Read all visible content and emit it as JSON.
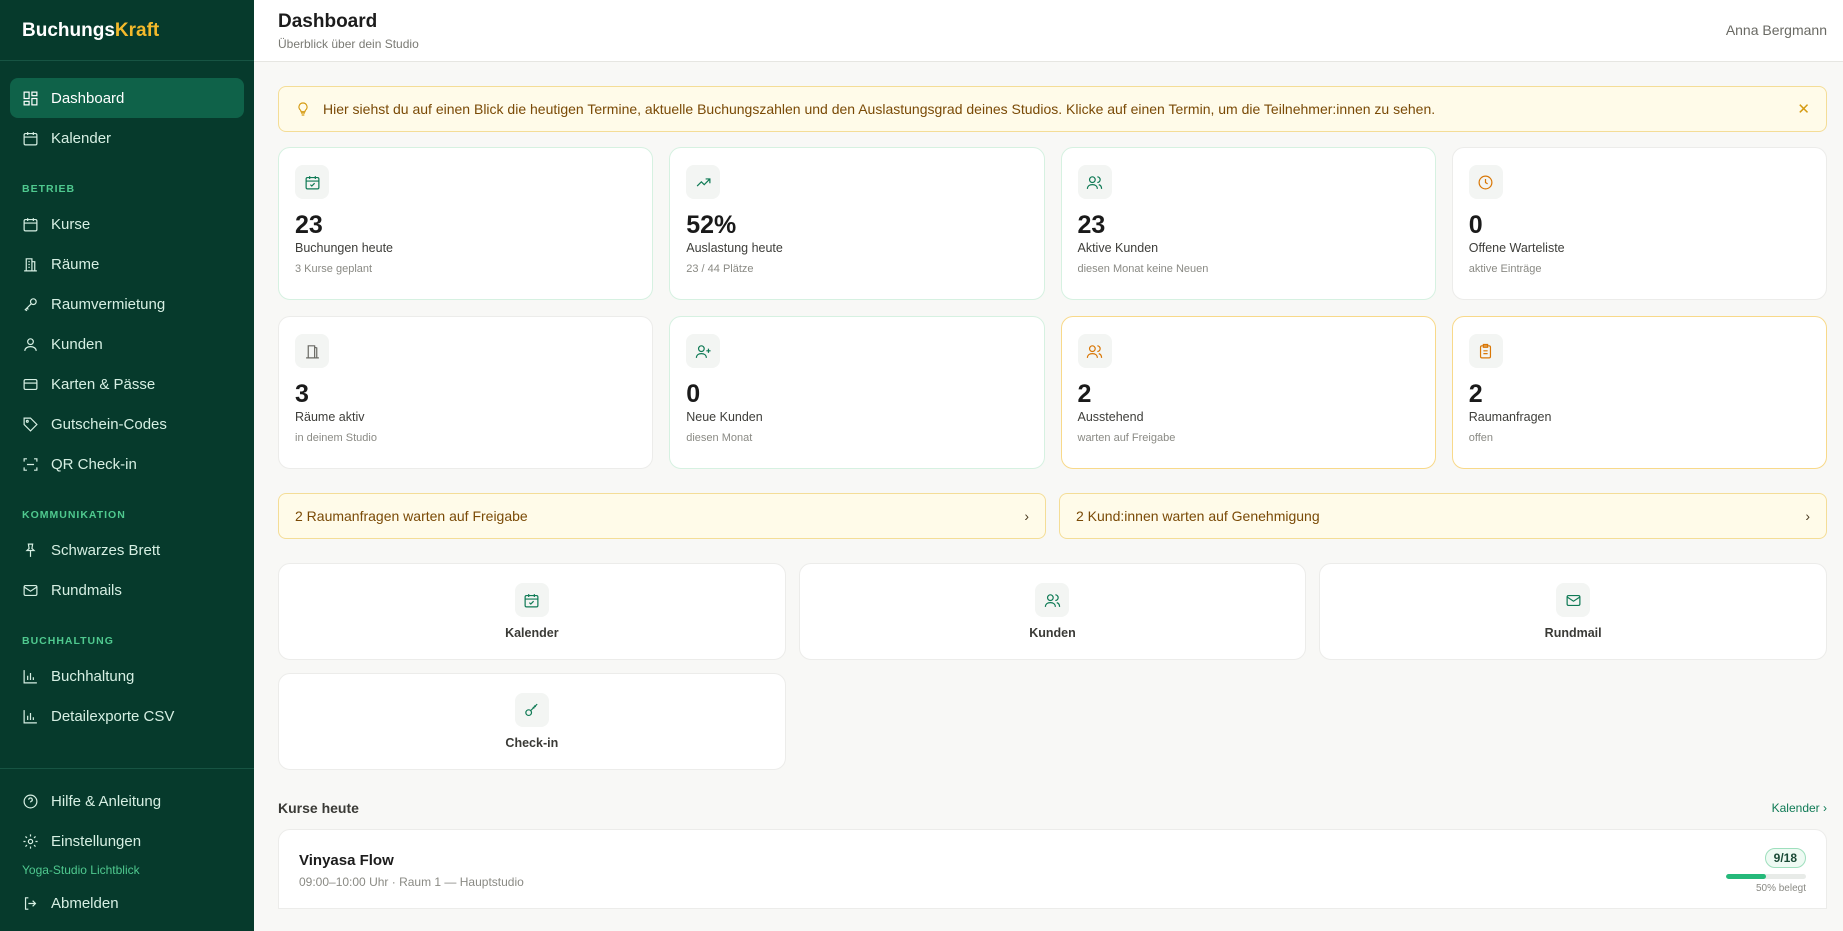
{
  "brand": {
    "part1": "Buchungs",
    "part2": "Kraft"
  },
  "nav": {
    "dashboard": "Dashboard",
    "kalender": "Kalender",
    "section_betrieb": "BETRIEB",
    "kurse": "Kurse",
    "raeume": "Räume",
    "raumvermietung": "Raumvermietung",
    "kunden": "Kunden",
    "karten": "Karten & Pässe",
    "gutschein": "Gutschein-Codes",
    "qr": "QR Check-in",
    "section_kommunikation": "KOMMUNIKATION",
    "brett": "Schwarzes Brett",
    "rundmails": "Rundmails",
    "section_buchhaltung": "BUCHHALTUNG",
    "buchhaltung": "Buchhaltung",
    "exporte": "Detailexporte CSV",
    "hilfe": "Hilfe & Anleitung",
    "einstellungen": "Einstellungen",
    "studio": "Yoga-Studio Lichtblick",
    "abmelden": "Abmelden"
  },
  "header": {
    "title": "Dashboard",
    "subtitle": "Überblick über dein Studio",
    "user": "Anna Bergmann"
  },
  "info": {
    "text": "Hier siehst du auf einen Blick die heutigen Termine, aktuelle Buchungszahlen und den Auslastungsgrad deines Studios. Klicke auf einen Termin, um die Teilnehmer:innen zu sehen.",
    "close": "✕"
  },
  "stats": [
    {
      "value": "23",
      "label": "Buchungen heute",
      "sub": "3 Kurse geplant",
      "icon": "calendar-check-icon"
    },
    {
      "value": "52%",
      "label": "Auslastung heute",
      "sub": "23 / 44 Plätze",
      "icon": "trending-up-icon"
    },
    {
      "value": "23",
      "label": "Aktive Kunden",
      "sub": "diesen Monat keine Neuen",
      "icon": "users-icon"
    },
    {
      "value": "0",
      "label": "Offene Warteliste",
      "sub": "aktive Einträge",
      "icon": "clock-icon"
    },
    {
      "value": "3",
      "label": "Räume aktiv",
      "sub": "in deinem Studio",
      "icon": "door-icon"
    },
    {
      "value": "0",
      "label": "Neue Kunden",
      "sub": "diesen Monat",
      "icon": "user-plus-icon"
    },
    {
      "value": "2",
      "label": "Ausstehend",
      "sub": "warten auf Freigabe",
      "icon": "users-icon"
    },
    {
      "value": "2",
      "label": "Raumanfragen",
      "sub": "offen",
      "icon": "clipboard-icon"
    }
  ],
  "alerts": [
    {
      "text": "2 Raumanfragen warten auf Freigabe",
      "chev": "›"
    },
    {
      "text": "2 Kund:innen warten auf Genehmigung",
      "chev": "›"
    }
  ],
  "quick": [
    {
      "label": "Kalender",
      "icon": "calendar-check-icon"
    },
    {
      "label": "Kunden",
      "icon": "users-icon"
    },
    {
      "label": "Rundmail",
      "icon": "mail-icon"
    },
    {
      "label": "Check-in",
      "icon": "key-icon"
    }
  ],
  "courses": {
    "title": "Kurse heute",
    "link": "Kalender ›",
    "items": [
      {
        "name": "Vinyasa Flow",
        "meta": "09:00–10:00 Uhr · Raum 1 — Hauptstudio",
        "badge": "9/18",
        "occupancy": 0.5,
        "occupancy_label": "50% belegt"
      }
    ]
  },
  "colors": {
    "sidebar": "#063a2c",
    "accent": "#f3b92b",
    "green": "#0f7a55",
    "amber": "#d97706"
  }
}
